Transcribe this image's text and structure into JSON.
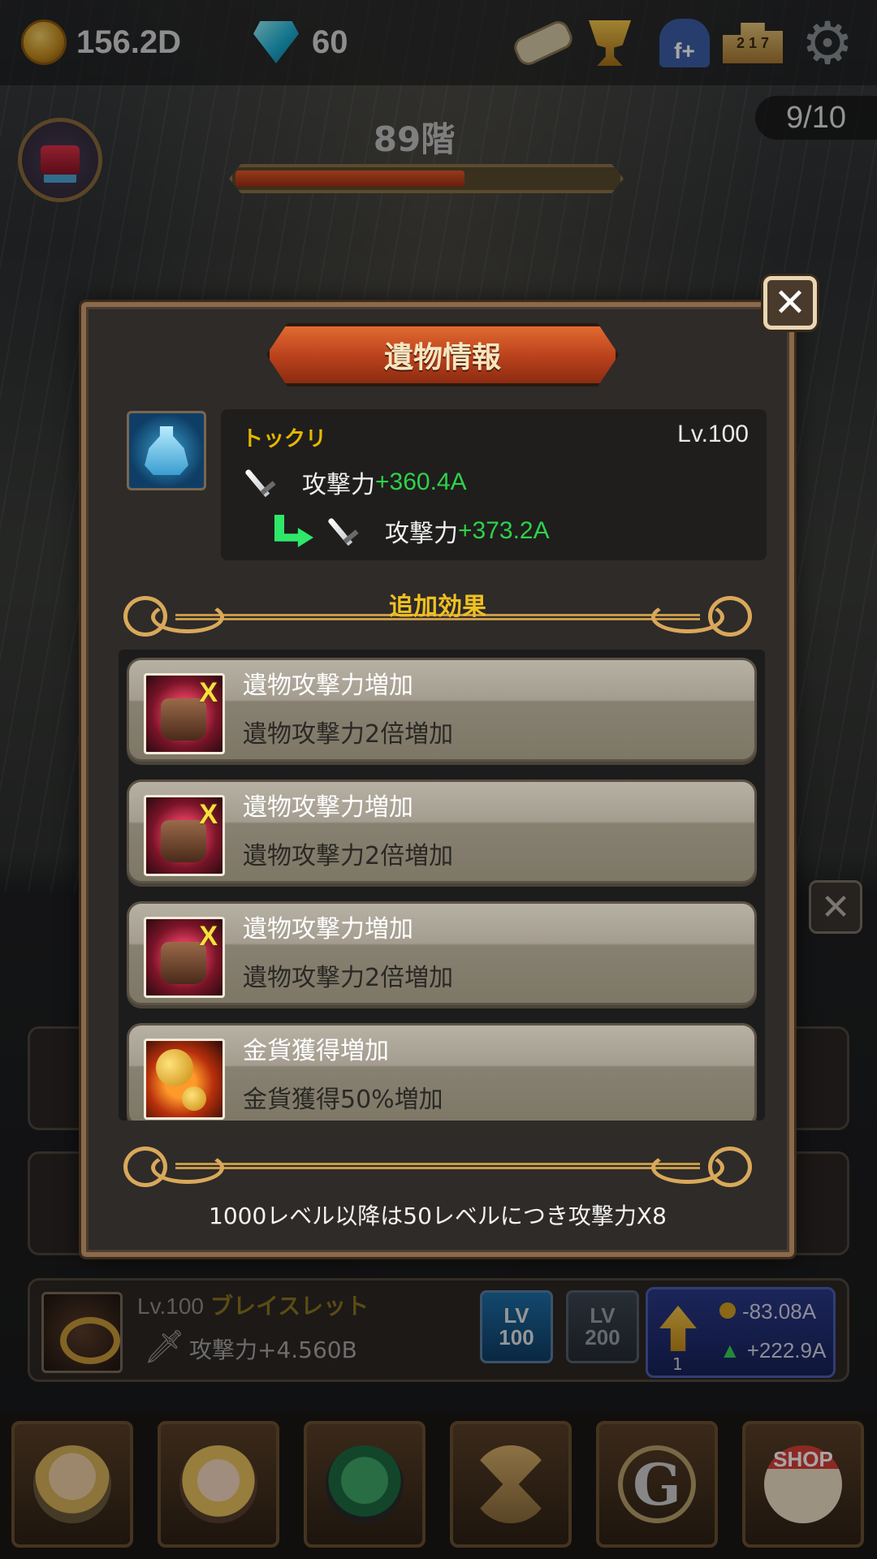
{
  "resources": {
    "gold": "156.2D",
    "gems": "60"
  },
  "top_icons": [
    "scroll-icon",
    "trophy-icon",
    "facebook-friend-icon",
    "ranking-icon",
    "gear-icon"
  ],
  "stage": {
    "floor": "89階",
    "count": "9/10",
    "boss_hp_fraction": 0.6
  },
  "modal": {
    "title": "遺物情報",
    "relic": {
      "name": "トックリ",
      "level": "Lv.100",
      "current_stat_label": "攻撃力",
      "current_stat_value": "+360.4A",
      "next_stat_label": "攻撃力",
      "next_stat_value": "+373.2A"
    },
    "section_title": "追加効果",
    "effects": [
      {
        "icon": "fist-icon",
        "title": "遺物攻撃力増加",
        "desc": "遺物攻撃力2倍増加"
      },
      {
        "icon": "fist-icon",
        "title": "遺物攻撃力増加",
        "desc": "遺物攻撃力2倍増加"
      },
      {
        "icon": "fist-icon",
        "title": "遺物攻撃力増加",
        "desc": "遺物攻撃力2倍増加"
      },
      {
        "icon": "gold-coin-icon",
        "title": "金貨獲得増加",
        "desc": "金貨獲得50%増加"
      }
    ],
    "footer_note": "1000レベル以降は50レベルにつき攻撃力X8",
    "close_label": "✕"
  },
  "background_item": {
    "level": "Lv.100",
    "name": "ブレイスレット",
    "stat": "攻撃力+4.560B",
    "lv_buttons": [
      {
        "top": "LV",
        "bottom": "100"
      },
      {
        "top": "LV",
        "bottom": "200"
      }
    ],
    "upgrade": {
      "cost": "-83.08A",
      "gain": "+222.9A",
      "count": "1"
    }
  },
  "bottom_nav": [
    "hero",
    "companion",
    "dragon-pet",
    "hourglass",
    "guild",
    "shop"
  ],
  "shop_label": "SHOP",
  "guild_label": "G",
  "colors": {
    "accent_orange": "#c8481e",
    "gain_green": "#2fd14a",
    "gold_text": "#f0c020"
  }
}
